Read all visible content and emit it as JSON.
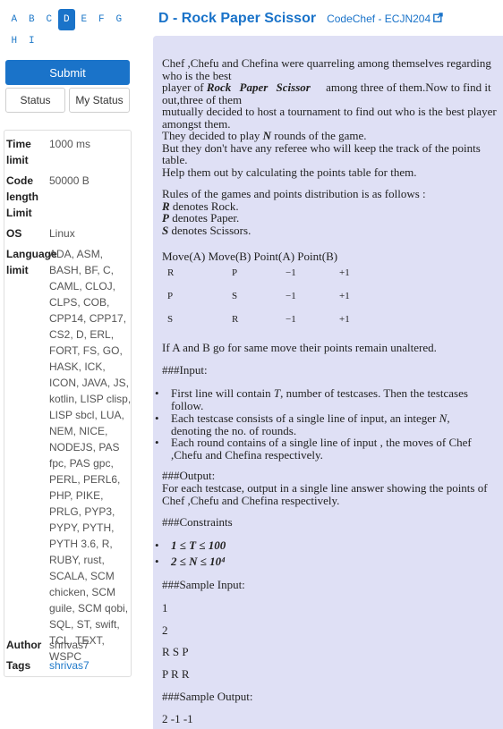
{
  "nav_letters": {
    "row1": [
      "A",
      "B",
      "C",
      "D",
      "E",
      "F",
      "G"
    ],
    "row2": [
      "H",
      "I"
    ],
    "active": "D"
  },
  "buttons": {
    "submit": "Submit",
    "status": "Status",
    "my_status": "My Status"
  },
  "info": {
    "time_limit_label": "Time limit",
    "time_limit_value": "1000 ms",
    "code_length_label": "Code length Limit",
    "code_length_value": "50000 B",
    "os_label": "OS",
    "os_value": "Linux",
    "language_label": "Language limit",
    "language_value": "ADA, ASM, BASH, BF, C, CAML, CLOJ, CLPS, COB, CPP14, CPP17, CS2, D, ERL, FORT, FS, GO, HASK, ICK, ICON, JAVA, JS, kotlin, LISP clisp, LISP sbcl, LUA, NEM, NICE, NODEJS, PAS fpc, PAS gpc, PERL, PERL6, PHP, PIKE, PRLG, PYP3, PYPY, PYTH, PYTH 3.6, R, RUBY, rust, SCALA, SCM chicken, SCM guile, SCM qobi, SQL, ST, swift, TCL, TEXT, WSPC",
    "author_label": "Author",
    "author_value": "shrivas7",
    "tags_label": "Tags",
    "tags_value": "shrivas7"
  },
  "problem": {
    "title": "D - Rock Paper Scissor",
    "source": "CodeChef - ECJN204",
    "p1_a": "Chef ,Chefu and Chefina were quarreling among themselves regarding who is the best",
    "p1_b": "player of",
    "p1_rock": "Rock",
    "p1_paper": "Paper",
    "p1_scissor": "Scissor",
    "p1_c": "among three of them.Now to find it out,three of them",
    "p1_d": "mutually decided to host a tournament to find out who is the best player amongst them.",
    "p1_e1": "They decided to play",
    "p1_e_var": "N",
    "p1_e2": "rounds of the game.",
    "p1_f": "But they don't have any referee who will keep the track of the points table.",
    "p1_g": "Help them out by calculating the points table for them.",
    "rules_intro": "Rules of the games and points distribution is as follows :",
    "rule_r_var": "R",
    "rule_r": "denotes Rock.",
    "rule_p_var": "P",
    "rule_p": "denotes Paper.",
    "rule_s_var": "S",
    "rule_s": "denotes Scissors.",
    "table_header": "Move(A) Move(B) Point(A) Point(B)",
    "table_rows": [
      [
        "R",
        "P",
        "−1",
        "+1"
      ],
      [
        "P",
        "S",
        "−1",
        "+1"
      ],
      [
        "S",
        "R",
        "−1",
        "+1"
      ]
    ],
    "same_move": "If A and B go for same move their points remain unaltered.",
    "input_heading": "###Input:",
    "input_b1_a": "First line will contain",
    "input_b1_var": "T",
    "input_b1_b": ", number of testcases. Then the testcases follow.",
    "input_b2_a": "Each testcase consists of a single line of input, an integer",
    "input_b2_var": "N",
    "input_b2_b": ", denoting the no. of rounds.",
    "input_b3": "Each round contains of a single line of input , the moves of Chef ,Chefu and Chefina respectively.",
    "output_heading": "###Output:",
    "output_text": "For each testcase, output in a single line answer showing the points of Chef ,Chefu and Chefina respectively.",
    "constraints_heading": "###Constraints",
    "constraint1": "1 ≤ T ≤ 100",
    "constraint2": "2 ≤ N ≤ 10⁴",
    "sample_input_heading": "###Sample Input:",
    "sample_input_lines": [
      "1",
      "2",
      "R S P",
      "P R R"
    ],
    "sample_output_heading": "###Sample Output:",
    "sample_output_lines": [
      "2 -1 -1"
    ]
  }
}
